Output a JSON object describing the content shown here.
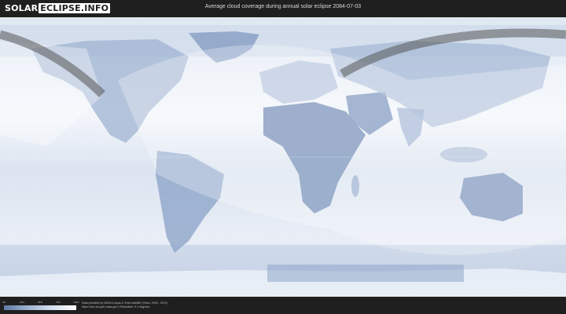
{
  "header": {
    "logo_part1": "SOLAR",
    "logo_part2": "ECLIPSE.INFO",
    "title": "Average cloud coverage during annual solar eclipse 2084-07-03"
  },
  "legend": {
    "ticks": [
      "0%",
      "25%",
      "50%",
      "75%",
      "100%"
    ],
    "colors": [
      "#5f7aa5",
      "#9db2cf",
      "#d4deed",
      "#ffffff"
    ]
  },
  "credits": {
    "line1": "Data provided by NASA's Aqua & Terra satellite (Years: 2000 - 2019)",
    "line2": "https://neo.sci.gsfc.nasa.gov | Resolution: 0.1 degrees"
  },
  "map": {
    "land_color": "#6b86b3",
    "ocean_color": "#f2f5fa",
    "eclipse_path_color": "#555555"
  }
}
